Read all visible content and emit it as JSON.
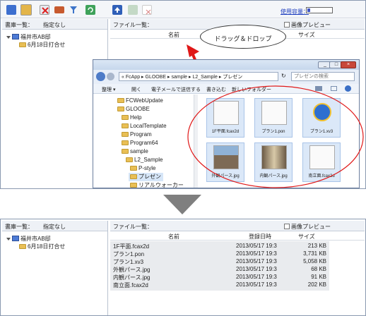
{
  "top": {
    "toolbar_icons": [
      "open-icon",
      "new-folder-icon",
      "delete-icon",
      "properties-icon",
      "filter-icon",
      "refresh-icon",
      "upload-icon",
      "download-icon",
      "cancel-icon"
    ],
    "usage_label": "使用容量：",
    "usage_fraction": 0.1,
    "left_header_label": "書庫一覧：",
    "left_header_value": "指定なし",
    "right_header_label": "ファイル一覧：",
    "image_preview_label": "画像プレビュー",
    "col_name": "名前",
    "col_size": "サイズ",
    "tree_root": "福井市AB邸",
    "tree_child": "6月18日打合せ"
  },
  "callout": "ドラッグ＆ドロップ",
  "explorer": {
    "address_parts": [
      "«",
      "FcApp",
      "GLOOBE",
      "sample",
      "L2_Sample",
      "プレゼン"
    ],
    "search_placeholder": "プレゼンの検索",
    "menu": [
      "整理 ▾",
      "開く",
      "電子メールで送信する",
      "書き込む",
      "新しいフォルダー"
    ],
    "tree": [
      "FCWebUpdate",
      "GLOOBE",
      "Help",
      "LocalTemplate",
      "Program",
      "Program64",
      "sample",
      "L2_Sample",
      "P-style",
      "プレゼン",
      "リアルウォーカー"
    ],
    "files": [
      "1F平面.fcax2d",
      "プラン1.pon",
      "プラン1.xv3",
      "外観パース.jpg",
      "内観パース.jpg",
      "南立面.fcax2d"
    ]
  },
  "bottom": {
    "left_header_label": "書庫一覧：",
    "left_header_value": "指定なし",
    "right_header_label": "ファイル一覧：",
    "image_preview_label": "画像プレビュー",
    "col_name": "名前",
    "col_date": "登録日時",
    "col_size": "サイズ",
    "tree_root": "福井市AB邸",
    "tree_child": "6月18日打合せ",
    "rows": [
      {
        "name": "1F平面.fcax2d",
        "date": "2013/05/17 19:3",
        "size": "213 KB"
      },
      {
        "name": "プラン1.pon",
        "date": "2013/05/17 19:3",
        "size": "3,731 KB"
      },
      {
        "name": "プラン1.xv3",
        "date": "2013/05/17 19:3",
        "size": "5,058 KB"
      },
      {
        "name": "外観パース.jpg",
        "date": "2013/05/17 19:3",
        "size": "68 KB"
      },
      {
        "name": "内観パース.jpg",
        "date": "2013/05/17 19:3",
        "size": "91 KB"
      },
      {
        "name": "南立面.fcax2d",
        "date": "2013/05/17 19:3",
        "size": "202 KB"
      }
    ]
  }
}
